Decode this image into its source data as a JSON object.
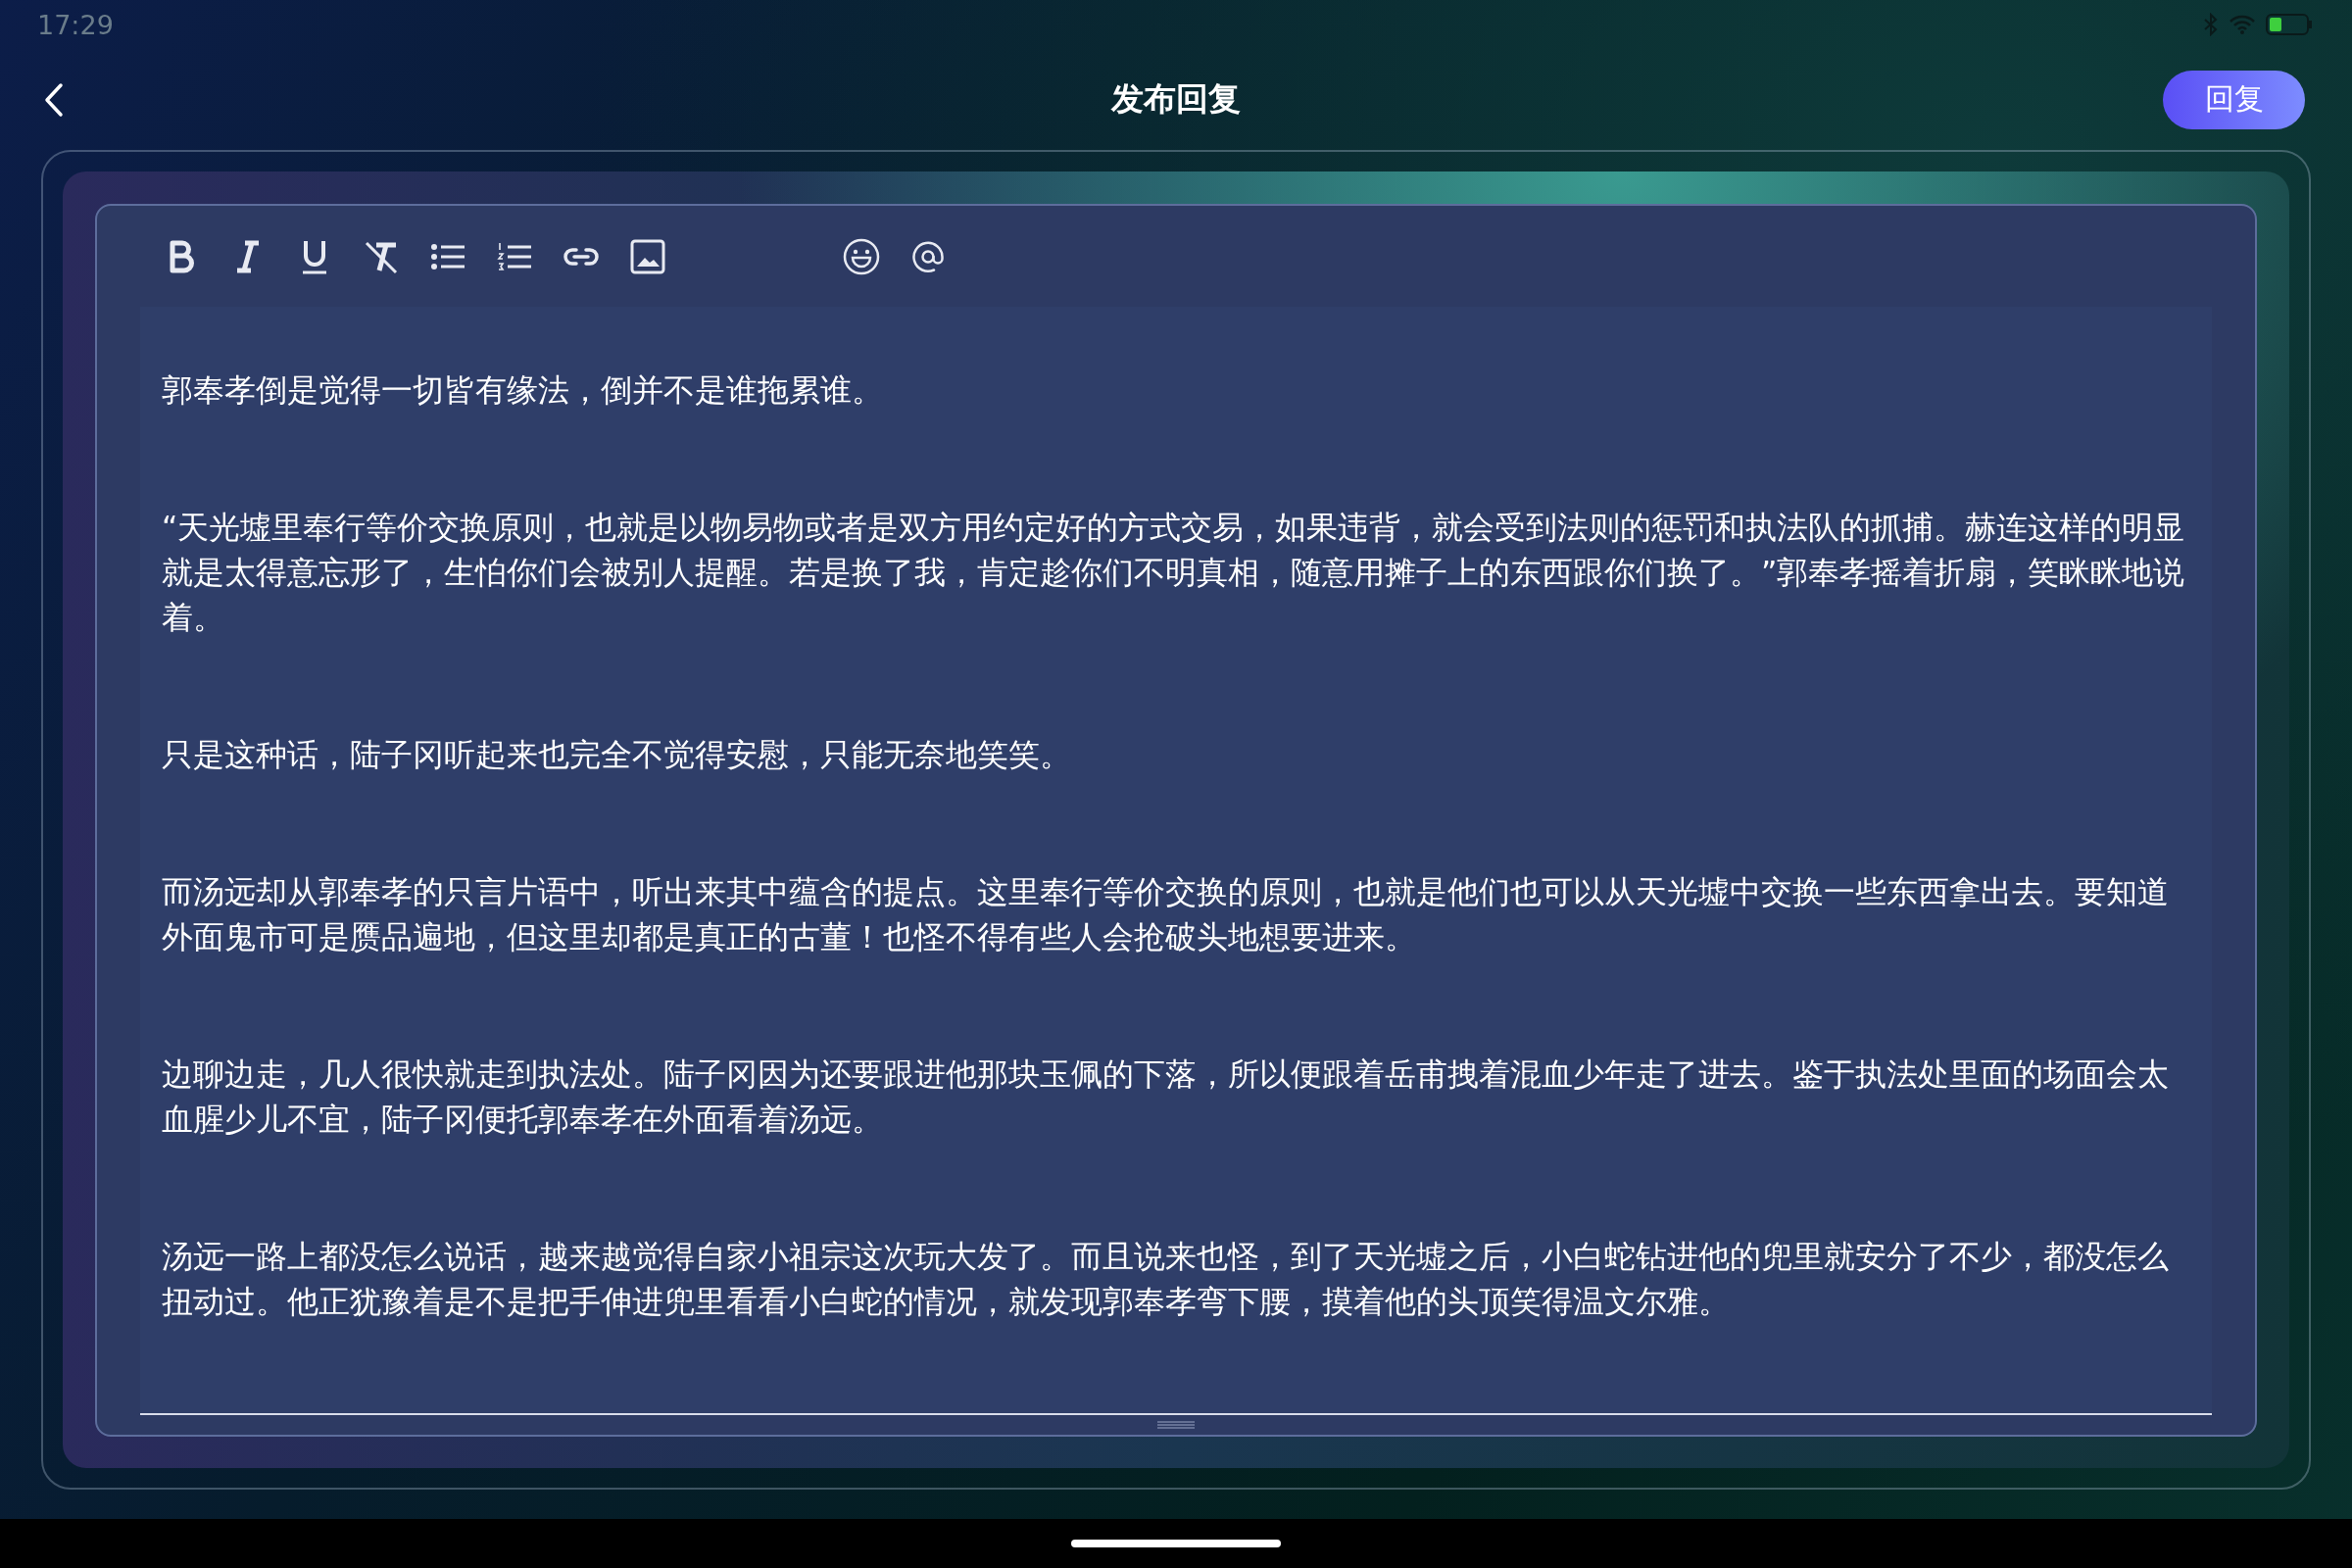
{
  "status_bar": {
    "time": "17:29"
  },
  "header": {
    "title": "发布回复",
    "reply_button": "回复"
  },
  "editor": {
    "paragraphs": [
      "郭奉孝倒是觉得一切皆有缘法，倒并不是谁拖累谁。",
      "“天光墟里奉行等价交换原则，也就是以物易物或者是双方用约定好的方式交易，如果违背，就会受到法则的惩罚和执法队的抓捕。赫连这样的明显就是太得意忘形了，生怕你们会被别人提醒。若是换了我，肯定趁你们不明真相，随意用摊子上的东西跟你们换了。”郭奉孝摇着折扇，笑眯眯地说着。",
      "只是这种话，陆子冈听起来也完全不觉得安慰，只能无奈地笑笑。",
      "而汤远却从郭奉孝的只言片语中，听出来其中蕴含的提点。这里奉行等价交换的原则，也就是他们也可以从天光墟中交换一些东西拿出去。要知道外面鬼市可是赝品遍地，但这里却都是真正的古董！也怪不得有些人会抢破头地想要进来。",
      "边聊边走，几人很快就走到执法处。陆子冈因为还要跟进他那块玉佩的下落，所以便跟着岳甫拽着混血少年走了进去。鉴于执法处里面的场面会太血腥少儿不宜，陆子冈便托郭奉孝在外面看着汤远。",
      "汤远一路上都没怎么说话，越来越觉得自家小祖宗这次玩大发了。而且说来也怪，到了天光墟之后，小白蛇钻进他的兜里就安分了不少，都没怎么扭动过。他正犹豫着是不是把手伸进兜里看看小白蛇的情况，就发现郭奉孝弯下腰，摸着他的头顶笑得温文尔雅。"
    ]
  }
}
